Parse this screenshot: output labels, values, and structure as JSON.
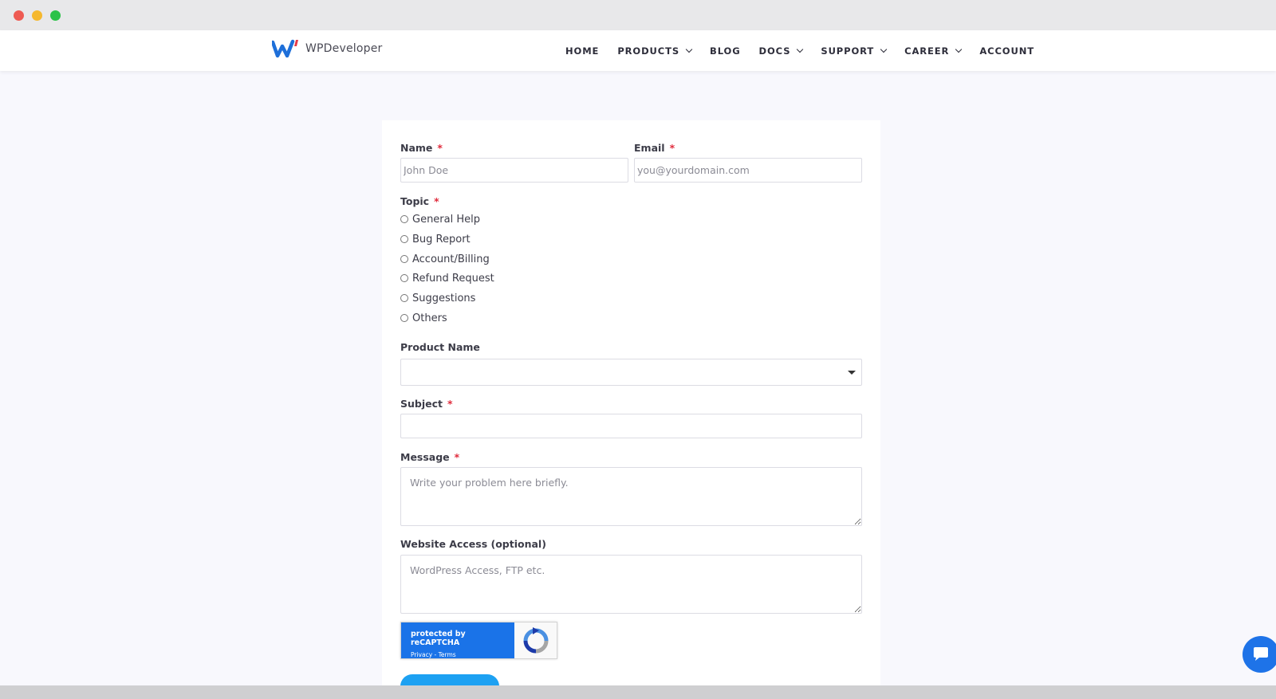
{
  "brand": {
    "name": "WPDeveloper",
    "colors": {
      "accent": "#1da1f2",
      "logo_blue": "#1e6fd9",
      "logo_red": "#e63946",
      "required": "#e02b3c"
    }
  },
  "nav": {
    "items": [
      {
        "label": "HOME",
        "has_dropdown": false
      },
      {
        "label": "PRODUCTS",
        "has_dropdown": true
      },
      {
        "label": "BLOG",
        "has_dropdown": false
      },
      {
        "label": "DOCS",
        "has_dropdown": true
      },
      {
        "label": "SUPPORT",
        "has_dropdown": true
      },
      {
        "label": "CAREER",
        "has_dropdown": true
      },
      {
        "label": "ACCOUNT",
        "has_dropdown": false
      }
    ]
  },
  "form": {
    "name": {
      "label": "Name",
      "required_mark": "*",
      "placeholder": "John Doe",
      "value": ""
    },
    "email": {
      "label": "Email",
      "required_mark": "*",
      "placeholder": "you@yourdomain.com",
      "value": ""
    },
    "topic": {
      "label": "Topic",
      "required_mark": "*",
      "options": [
        "General Help",
        "Bug Report",
        "Account/Billing",
        "Refund Request",
        "Suggestions",
        "Others"
      ]
    },
    "product": {
      "label": "Product Name",
      "selected": ""
    },
    "subject": {
      "label": "Subject",
      "required_mark": "*",
      "value": ""
    },
    "message": {
      "label": "Message",
      "required_mark": "*",
      "placeholder": "Write your problem here briefly."
    },
    "website_access": {
      "label": "Website Access (optional)",
      "placeholder": "WordPress Access, FTP etc."
    },
    "recaptcha": {
      "text": "protected by reCAPTCHA",
      "links": "Privacy - Terms"
    }
  },
  "icons": {
    "chat": "chat-bubble-icon",
    "dropdown": "chevron-down-icon",
    "recaptcha": "recaptcha-logo-icon"
  }
}
